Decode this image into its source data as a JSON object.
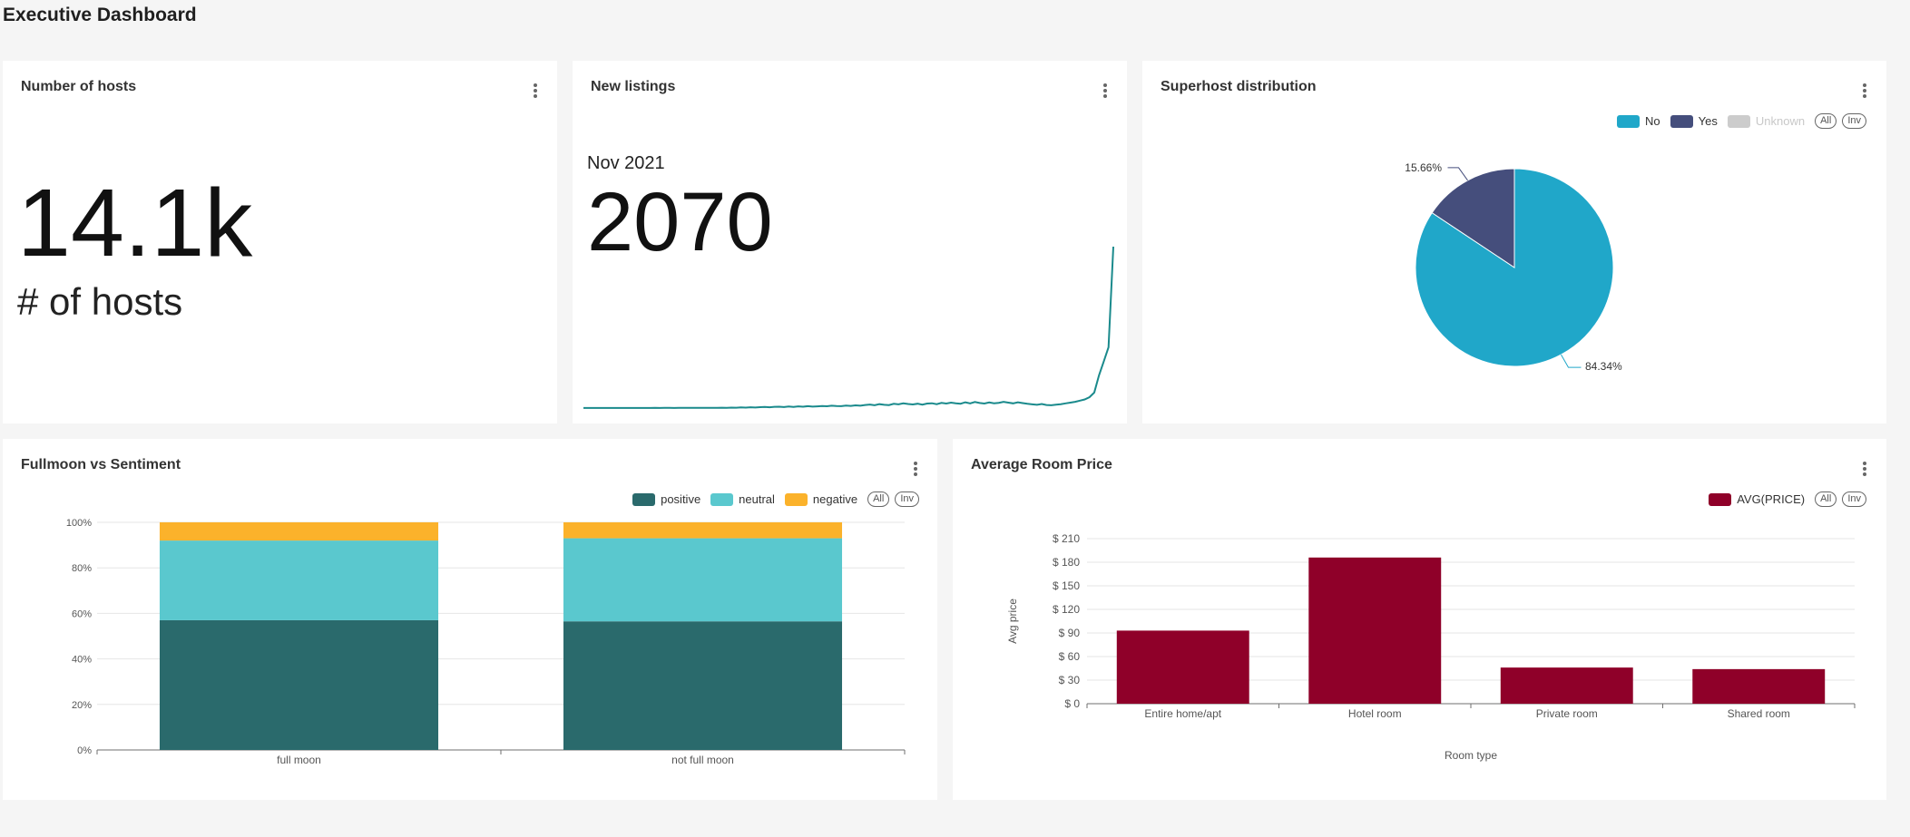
{
  "page": {
    "title": "Executive Dashboard"
  },
  "cards": {
    "hosts": {
      "title": "Number of hosts",
      "value": "14.1k",
      "subheader": "# of hosts"
    },
    "listings": {
      "title": "New listings",
      "period": "Nov 2021",
      "value": "2070"
    },
    "superhost": {
      "title": "Superhost distribution"
    },
    "fullmoon": {
      "title": "Fullmoon vs Sentiment"
    },
    "price": {
      "title": "Average Room Price"
    }
  },
  "legend_controls": {
    "all": "All",
    "inv": "Inv"
  },
  "icons": {
    "menu": "kebab-menu-icon"
  },
  "chart_data": [
    {
      "type": "line",
      "id": "new-listings-trend",
      "title": "",
      "color": "#1a8a8c",
      "values": [
        1,
        1,
        1,
        1,
        1,
        1,
        1,
        1,
        1,
        1,
        1,
        1,
        1,
        1,
        1,
        2,
        1,
        2,
        2,
        1,
        2,
        2,
        3,
        2,
        3,
        3,
        2,
        4,
        3,
        5,
        4,
        6,
        5,
        8,
        6,
        10,
        7,
        12,
        14,
        10,
        16,
        18,
        13,
        20,
        15,
        22,
        17,
        25,
        19,
        22,
        27,
        23,
        30,
        26,
        24,
        32,
        28,
        35,
        30,
        40,
        45,
        36,
        50,
        42,
        38,
        55,
        48,
        60,
        52,
        46,
        56,
        44,
        58,
        62,
        50,
        66,
        58,
        70,
        62,
        56,
        74,
        60,
        78,
        65,
        58,
        72,
        62,
        68,
        80,
        70,
        60,
        75,
        64,
        55,
        48,
        42,
        52,
        40,
        36,
        44,
        50,
        60,
        70,
        80,
        95,
        110,
        140,
        200,
        420,
        600,
        780,
        2070
      ],
      "ylim": [
        0,
        2070
      ]
    },
    {
      "type": "pie",
      "id": "superhost-distribution",
      "title": "",
      "labels": [
        "No",
        "Yes",
        "Unknown"
      ],
      "values": [
        84.34,
        15.66,
        0
      ],
      "value_labels": [
        "84.34%",
        "15.66%",
        ""
      ],
      "colors": [
        "#20a7c9",
        "#454e7c",
        "#cccccc"
      ],
      "legend_position": "top-right",
      "legend_inactive": [
        "Unknown"
      ]
    },
    {
      "type": "bar",
      "id": "fullmoon-vs-sentiment",
      "title": "",
      "stacked": true,
      "categories": [
        "full moon",
        "not full moon"
      ],
      "series": [
        {
          "name": "positive",
          "color": "#2a6a6c",
          "values": [
            57,
            56.5
          ]
        },
        {
          "name": "neutral",
          "color": "#5ac8ce",
          "values": [
            35,
            36.5
          ]
        },
        {
          "name": "negative",
          "color": "#fbb22b",
          "values": [
            8,
            7
          ]
        }
      ],
      "yticks": [
        "0%",
        "20%",
        "40%",
        "60%",
        "80%",
        "100%"
      ],
      "ylim": [
        0,
        100
      ],
      "grid": true,
      "legend_position": "top-right"
    },
    {
      "type": "bar",
      "id": "average-room-price",
      "title": "",
      "categories": [
        "Entire home/apt",
        "Hotel room",
        "Private room",
        "Shared room"
      ],
      "series": [
        {
          "name": "AVG(PRICE)",
          "color": "#8f0029",
          "values": [
            93,
            186,
            46,
            44
          ]
        }
      ],
      "yticks": [
        "$ 0",
        "$ 30",
        "$ 60",
        "$ 90",
        "$ 120",
        "$ 150",
        "$ 180",
        "$ 210"
      ],
      "ylim": [
        0,
        210
      ],
      "xlabel": "Room type",
      "ylabel": "Avg price",
      "grid": true,
      "legend_position": "top-right"
    }
  ]
}
